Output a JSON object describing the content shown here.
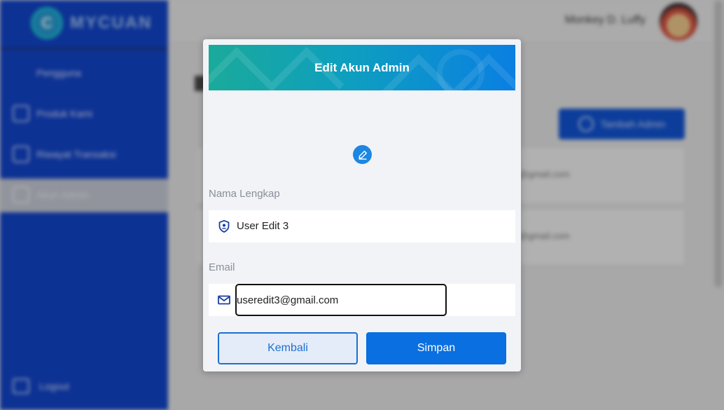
{
  "app": {
    "brand_initial": "C",
    "brand_name": "MYCUAN",
    "user_name": "Monkey D. Luffy"
  },
  "sidebar": {
    "items": [
      {
        "label": "Pengguna",
        "icon": "users-icon"
      },
      {
        "label": "Produk Kami",
        "icon": "calendar-icon"
      },
      {
        "label": "Riwayat Transaksi",
        "icon": "history-icon"
      },
      {
        "label": "Akun Admin",
        "icon": "admin-icon"
      }
    ],
    "logout_label": "Logout"
  },
  "main": {
    "add_admin_label": "Tambah Admin",
    "rows": [
      {
        "email": "@gmail.com"
      },
      {
        "email": "@gmail.com"
      }
    ]
  },
  "modal": {
    "title": "Edit Akun Admin",
    "name_label": "Nama Lengkap",
    "name_value": "User Edit 3",
    "email_label": "Email",
    "email_value": "useredit3@gmail.com",
    "back_label": "Kembali",
    "save_label": "Simpan"
  },
  "colors": {
    "sidebar": "#0a3fcc",
    "header_gradient_start": "#1aaa9b",
    "header_gradient_end": "#0a7fe2",
    "primary": "#0a6fe0"
  }
}
